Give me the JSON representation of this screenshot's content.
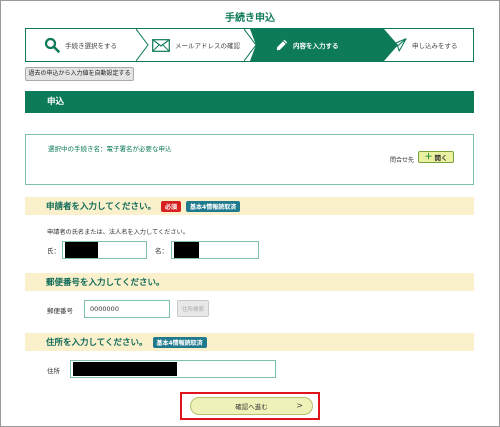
{
  "page": {
    "title": "手続き申込"
  },
  "steps": [
    {
      "label": "手続き選択をする",
      "icon": "search-icon",
      "active": false
    },
    {
      "label": "メールアドレスの確認",
      "icon": "mail-icon",
      "active": false
    },
    {
      "label": "内容を入力する",
      "icon": "pencil-icon",
      "active": true
    },
    {
      "label": "申し込みをする",
      "icon": "paper-plane-icon",
      "active": false
    }
  ],
  "autofill": {
    "label": "過去の申込から入力値を自動設定する"
  },
  "section": {
    "title": "申込"
  },
  "procedure": {
    "label": "選択中の手続き名：電子署名が必要な申込",
    "contact_label": "問合せ先",
    "open_label": "開く"
  },
  "applicant": {
    "title": "申請者を入力してください。",
    "badge_required": "必須",
    "badge_info": "基本4情報読取済",
    "note": "申請者の氏名または、法人名を入力してください。",
    "last_name_label": "氏：",
    "first_name_label": "名："
  },
  "postal": {
    "title": "郵便番号を入力してください。",
    "label": "郵便番号",
    "value": "0000000",
    "search_label": "住所検索"
  },
  "address": {
    "title": "住所を入力してください。",
    "badge_info": "基本4情報読取済",
    "label": "住所"
  },
  "confirm": {
    "label": "確認へ進む",
    "arrow": ">"
  },
  "colors": {
    "brand": "#0d7a5a",
    "required": "#d62020",
    "info_badge": "#1f7a8e",
    "question_bg": "#fbf0cc",
    "highlight": "#e0141e"
  }
}
